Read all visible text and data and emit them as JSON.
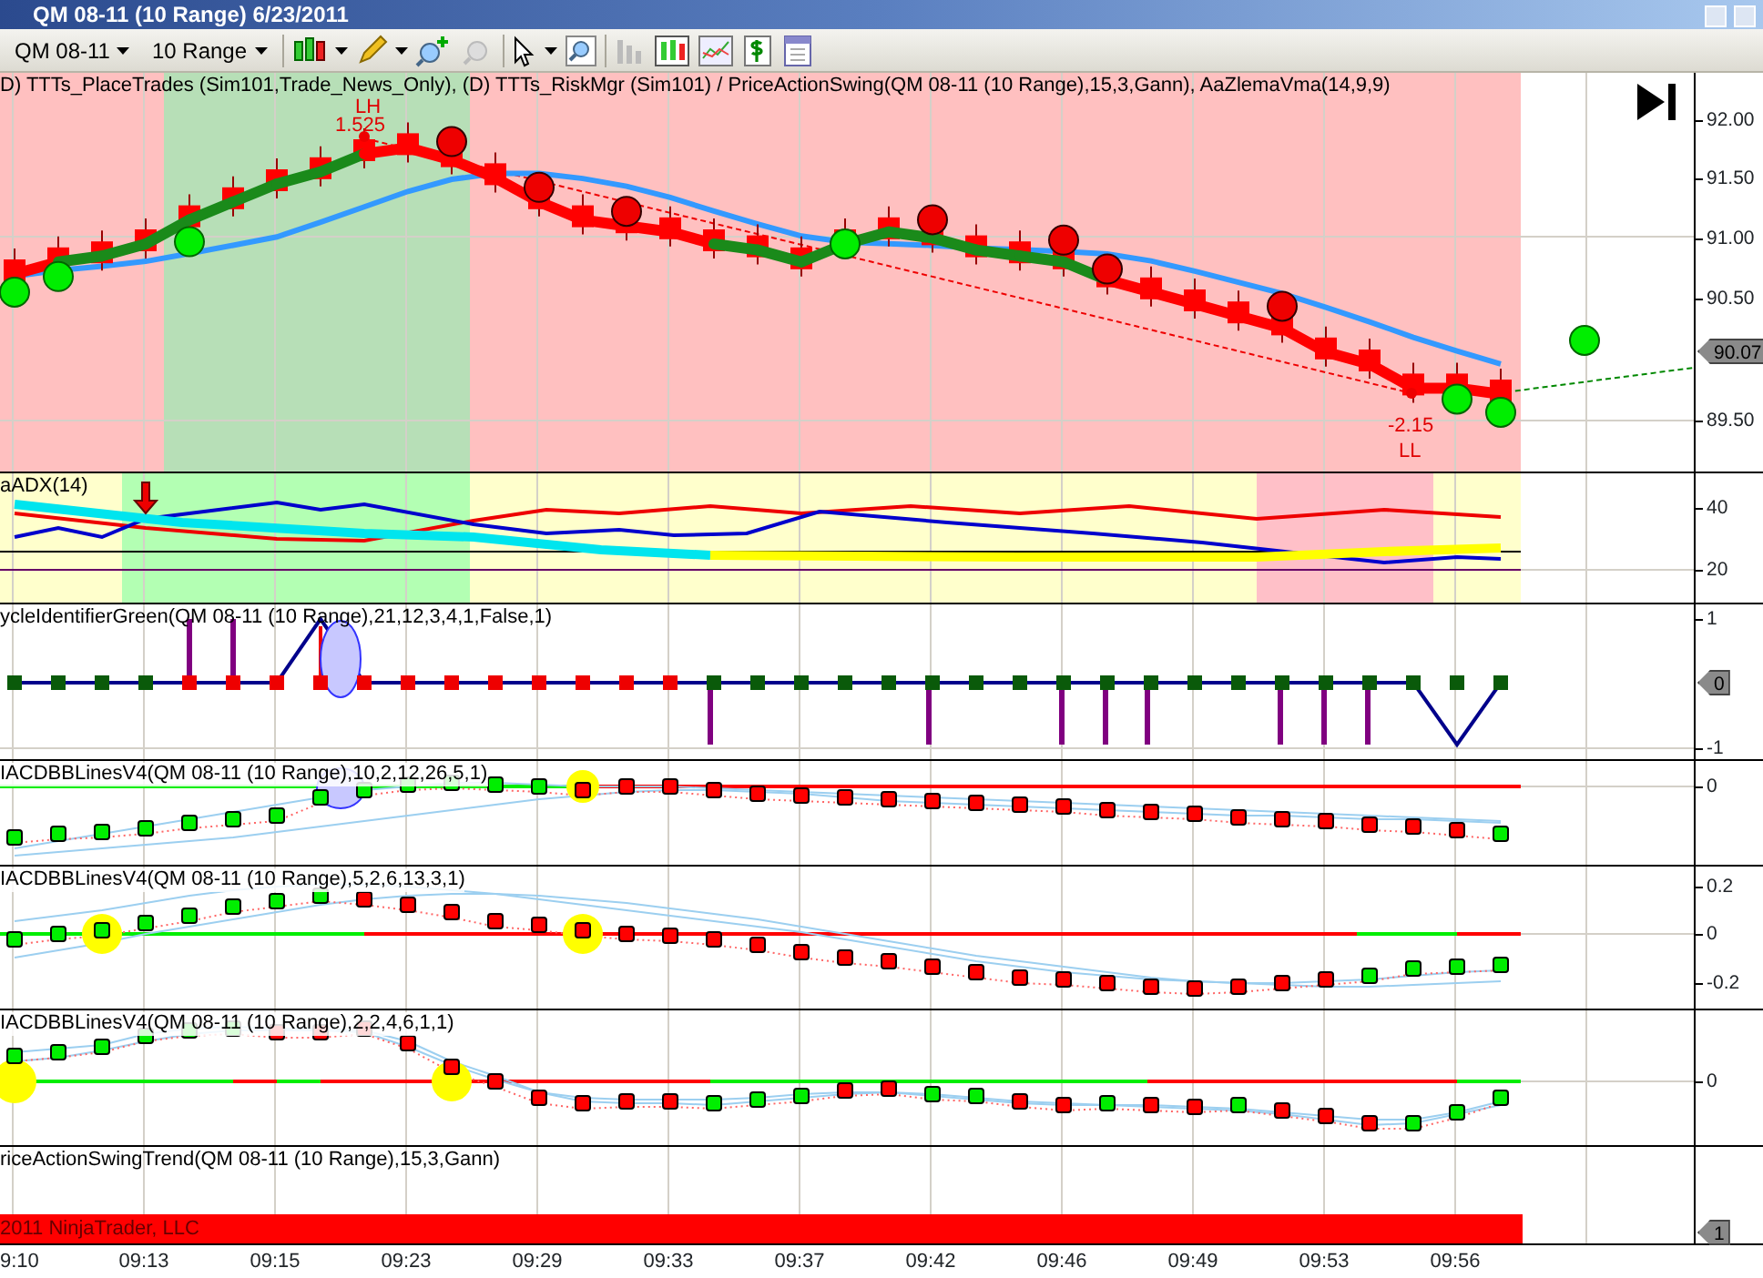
{
  "window": {
    "title": "QM 08-11 (10 Range)  6/23/2011"
  },
  "toolbar": {
    "instrument": "QM 08-11",
    "interval": "10 Range"
  },
  "panels": [
    {
      "kind": "price",
      "label": "D) TTTs_PlaceTrades (Sim101,Trade_News_Only), (D) TTTs_RiskMgr (Sim101) / PriceActionSwing(QM 08-11 (10 Range),15,3,Gann), AaZlemaVma(14,9,9)",
      "ticks": [
        "92.00",
        "91.50",
        "91.00",
        "90.50",
        "89.50"
      ],
      "marker": "90.07",
      "annotations": [
        {
          "kind": "high",
          "value": "1.525",
          "tag": "LH"
        },
        {
          "kind": "low",
          "value": "-2.15",
          "tag": "LL"
        }
      ]
    },
    {
      "kind": "adx",
      "label": "aADX(14)",
      "ticks": [
        "40",
        "20"
      ]
    },
    {
      "kind": "cycle",
      "label": "ycleIdentifierGreen(QM 08-11 (10 Range),21,12,3,4,1,False,1)",
      "ticks": [
        "1",
        "-1"
      ],
      "marker": "0"
    },
    {
      "kind": "macd1",
      "label": "IACDBBLinesV4(QM 08-11 (10 Range),10,2,12,26,5,1)",
      "ticks": [
        "0"
      ]
    },
    {
      "kind": "macd2",
      "label": "IACDBBLinesV4(QM 08-11 (10 Range),5,2,6,13,3,1)",
      "ticks": [
        "0.2",
        "0",
        "-0.2"
      ]
    },
    {
      "kind": "macd3",
      "label": "IACDBBLinesV4(QM 08-11 (10 Range),2,2,4,6,1,1)",
      "ticks": [
        "0"
      ]
    },
    {
      "kind": "trend",
      "label": "riceActionSwingTrend(QM 08-11 (10 Range),15,3,Gann)",
      "marker": "1",
      "footer": "2011 NinjaTrader, LLC"
    }
  ],
  "time_axis": [
    "9:10",
    "09:13",
    "09:15",
    "09:23",
    "09:29",
    "09:33",
    "09:37",
    "09:42",
    "09:46",
    "09:49",
    "09:53",
    "09:56"
  ]
}
